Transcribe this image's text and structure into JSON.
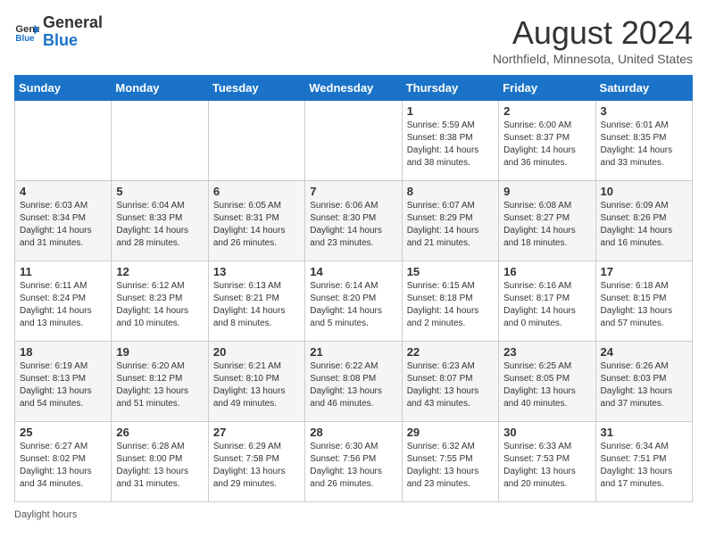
{
  "header": {
    "logo_line1": "General",
    "logo_line2": "Blue",
    "title": "August 2024",
    "subtitle": "Northfield, Minnesota, United States"
  },
  "days_of_week": [
    "Sunday",
    "Monday",
    "Tuesday",
    "Wednesday",
    "Thursday",
    "Friday",
    "Saturday"
  ],
  "weeks": [
    [
      {
        "day": "",
        "info": ""
      },
      {
        "day": "",
        "info": ""
      },
      {
        "day": "",
        "info": ""
      },
      {
        "day": "",
        "info": ""
      },
      {
        "day": "1",
        "info": "Sunrise: 5:59 AM\nSunset: 8:38 PM\nDaylight: 14 hours and 38 minutes."
      },
      {
        "day": "2",
        "info": "Sunrise: 6:00 AM\nSunset: 8:37 PM\nDaylight: 14 hours and 36 minutes."
      },
      {
        "day": "3",
        "info": "Sunrise: 6:01 AM\nSunset: 8:35 PM\nDaylight: 14 hours and 33 minutes."
      }
    ],
    [
      {
        "day": "4",
        "info": "Sunrise: 6:03 AM\nSunset: 8:34 PM\nDaylight: 14 hours and 31 minutes."
      },
      {
        "day": "5",
        "info": "Sunrise: 6:04 AM\nSunset: 8:33 PM\nDaylight: 14 hours and 28 minutes."
      },
      {
        "day": "6",
        "info": "Sunrise: 6:05 AM\nSunset: 8:31 PM\nDaylight: 14 hours and 26 minutes."
      },
      {
        "day": "7",
        "info": "Sunrise: 6:06 AM\nSunset: 8:30 PM\nDaylight: 14 hours and 23 minutes."
      },
      {
        "day": "8",
        "info": "Sunrise: 6:07 AM\nSunset: 8:29 PM\nDaylight: 14 hours and 21 minutes."
      },
      {
        "day": "9",
        "info": "Sunrise: 6:08 AM\nSunset: 8:27 PM\nDaylight: 14 hours and 18 minutes."
      },
      {
        "day": "10",
        "info": "Sunrise: 6:09 AM\nSunset: 8:26 PM\nDaylight: 14 hours and 16 minutes."
      }
    ],
    [
      {
        "day": "11",
        "info": "Sunrise: 6:11 AM\nSunset: 8:24 PM\nDaylight: 14 hours and 13 minutes."
      },
      {
        "day": "12",
        "info": "Sunrise: 6:12 AM\nSunset: 8:23 PM\nDaylight: 14 hours and 10 minutes."
      },
      {
        "day": "13",
        "info": "Sunrise: 6:13 AM\nSunset: 8:21 PM\nDaylight: 14 hours and 8 minutes."
      },
      {
        "day": "14",
        "info": "Sunrise: 6:14 AM\nSunset: 8:20 PM\nDaylight: 14 hours and 5 minutes."
      },
      {
        "day": "15",
        "info": "Sunrise: 6:15 AM\nSunset: 8:18 PM\nDaylight: 14 hours and 2 minutes."
      },
      {
        "day": "16",
        "info": "Sunrise: 6:16 AM\nSunset: 8:17 PM\nDaylight: 14 hours and 0 minutes."
      },
      {
        "day": "17",
        "info": "Sunrise: 6:18 AM\nSunset: 8:15 PM\nDaylight: 13 hours and 57 minutes."
      }
    ],
    [
      {
        "day": "18",
        "info": "Sunrise: 6:19 AM\nSunset: 8:13 PM\nDaylight: 13 hours and 54 minutes."
      },
      {
        "day": "19",
        "info": "Sunrise: 6:20 AM\nSunset: 8:12 PM\nDaylight: 13 hours and 51 minutes."
      },
      {
        "day": "20",
        "info": "Sunrise: 6:21 AM\nSunset: 8:10 PM\nDaylight: 13 hours and 49 minutes."
      },
      {
        "day": "21",
        "info": "Sunrise: 6:22 AM\nSunset: 8:08 PM\nDaylight: 13 hours and 46 minutes."
      },
      {
        "day": "22",
        "info": "Sunrise: 6:23 AM\nSunset: 8:07 PM\nDaylight: 13 hours and 43 minutes."
      },
      {
        "day": "23",
        "info": "Sunrise: 6:25 AM\nSunset: 8:05 PM\nDaylight: 13 hours and 40 minutes."
      },
      {
        "day": "24",
        "info": "Sunrise: 6:26 AM\nSunset: 8:03 PM\nDaylight: 13 hours and 37 minutes."
      }
    ],
    [
      {
        "day": "25",
        "info": "Sunrise: 6:27 AM\nSunset: 8:02 PM\nDaylight: 13 hours and 34 minutes."
      },
      {
        "day": "26",
        "info": "Sunrise: 6:28 AM\nSunset: 8:00 PM\nDaylight: 13 hours and 31 minutes."
      },
      {
        "day": "27",
        "info": "Sunrise: 6:29 AM\nSunset: 7:58 PM\nDaylight: 13 hours and 29 minutes."
      },
      {
        "day": "28",
        "info": "Sunrise: 6:30 AM\nSunset: 7:56 PM\nDaylight: 13 hours and 26 minutes."
      },
      {
        "day": "29",
        "info": "Sunrise: 6:32 AM\nSunset: 7:55 PM\nDaylight: 13 hours and 23 minutes."
      },
      {
        "day": "30",
        "info": "Sunrise: 6:33 AM\nSunset: 7:53 PM\nDaylight: 13 hours and 20 minutes."
      },
      {
        "day": "31",
        "info": "Sunrise: 6:34 AM\nSunset: 7:51 PM\nDaylight: 13 hours and 17 minutes."
      }
    ]
  ],
  "footer": "Daylight hours"
}
